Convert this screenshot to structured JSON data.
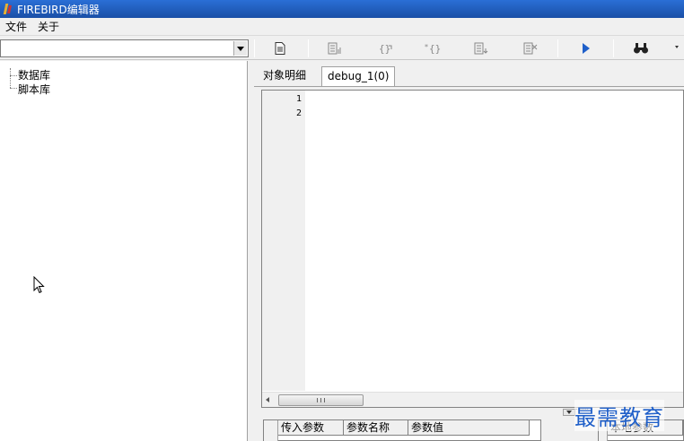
{
  "window": {
    "title": "FIREBIRD编辑器"
  },
  "menu": {
    "items": [
      "文件",
      "关于"
    ]
  },
  "toolbar": {
    "buttons": [
      "new-document-icon",
      "table-icon",
      "braces-icon",
      "star-braces-icon",
      "export-icon",
      "delete-icon",
      "run-icon",
      "find-icon"
    ]
  },
  "tree": {
    "items": [
      "数据库",
      "脚本库"
    ]
  },
  "tabs": [
    {
      "label": "对象明细",
      "active": false
    },
    {
      "label": "debug_1(0)",
      "active": true
    }
  ],
  "editor": {
    "line_numbers": [
      "1",
      "2"
    ]
  },
  "params_grid": {
    "columns": [
      "传入参数",
      "参数名称",
      "参数值"
    ]
  },
  "local_grid": {
    "columns": [
      "本地参数"
    ]
  },
  "watermark": {
    "text": "最需教育"
  },
  "colors": {
    "title_bar": "#1f5fc9",
    "run_icon": "#1f5fc9",
    "watermark": "#1f5fc9"
  }
}
